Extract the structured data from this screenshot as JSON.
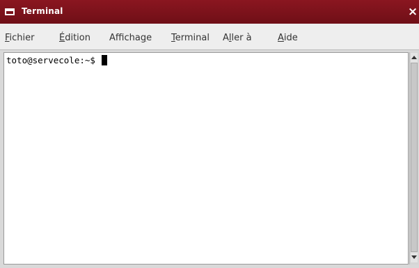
{
  "window": {
    "title": "Terminal",
    "close_glyph": "×",
    "icon": "terminal-window-icon",
    "titlebar_color": "#7a121b"
  },
  "menu": [
    {
      "mnemonic": "F",
      "rest": "ichier"
    },
    {
      "mnemonic": "É",
      "rest": "dition"
    },
    {
      "prefix": "Afficha",
      "mnemonic": "g",
      "rest": "e"
    },
    {
      "mnemonic": "T",
      "rest": "erminal"
    },
    {
      "prefix": "A",
      "mnemonic": "l",
      "rest": "ler à"
    },
    {
      "mnemonic": "A",
      "rest": "ide"
    }
  ],
  "terminal": {
    "prompt": "toto@servecole:~$ "
  }
}
